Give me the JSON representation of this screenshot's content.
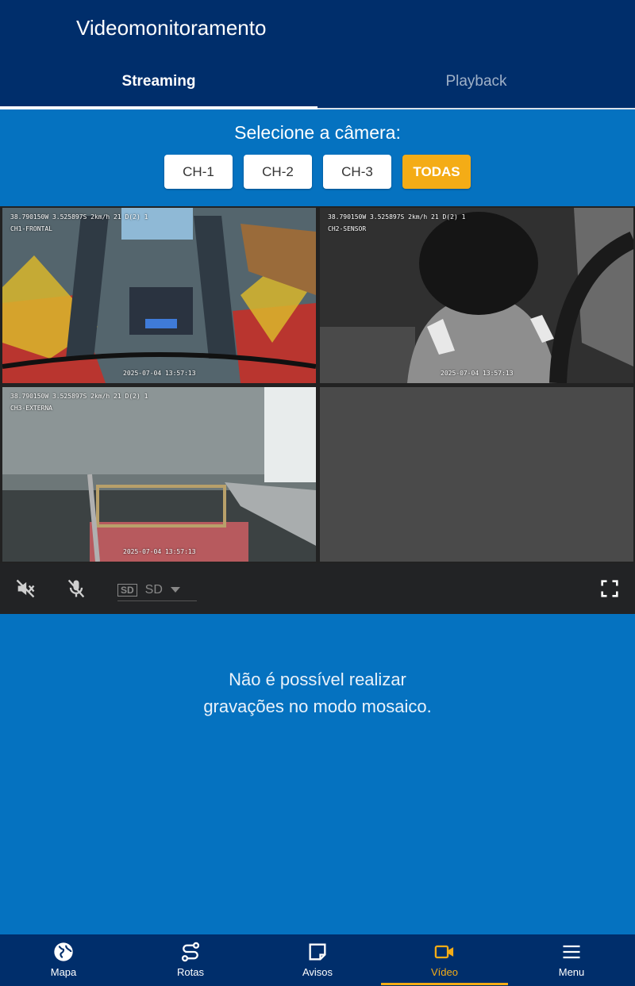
{
  "header": {
    "title": "Videomonitoramento"
  },
  "tabs": [
    {
      "label": "Streaming",
      "active": true
    },
    {
      "label": "Playback",
      "active": false
    }
  ],
  "selector": {
    "title": "Selecione a câmera:",
    "channels": [
      "CH-1",
      "CH-2",
      "CH-3",
      "TODAS"
    ],
    "selected": "TODAS"
  },
  "cameras": [
    {
      "coords": "38.790150W 3.525897S 2km/h 21 D(2) 1",
      "name": "CH1-FRONTAL",
      "timestamp": "2025-07-04 13:57:13"
    },
    {
      "coords": "38.790150W 3.525897S 2km/h 21 D(2) 1",
      "name": "CH2-SENSOR",
      "timestamp": "2025-07-04 13:57:13"
    },
    {
      "coords": "38.790150W 3.525897S 2km/h 21 D(2) 1",
      "name": "CH3-EXTERNA",
      "timestamp": "2025-07-04 13:57:13"
    }
  ],
  "controls": {
    "quality_badge": "SD",
    "quality_value": "SD"
  },
  "notice": {
    "line1": "Não é possível realizar",
    "line2": "gravações no modo mosaico."
  },
  "nav": [
    {
      "label": "Mapa",
      "icon": "globe-icon"
    },
    {
      "label": "Rotas",
      "icon": "route-icon"
    },
    {
      "label": "Avisos",
      "icon": "notice-icon"
    },
    {
      "label": "Vídeo",
      "icon": "video-camera-icon",
      "active": true
    },
    {
      "label": "Menu",
      "icon": "menu-icon"
    }
  ],
  "colors": {
    "header_bg": "#002e6b",
    "body_bg": "#0572c0",
    "accent": "#f4ac16"
  }
}
